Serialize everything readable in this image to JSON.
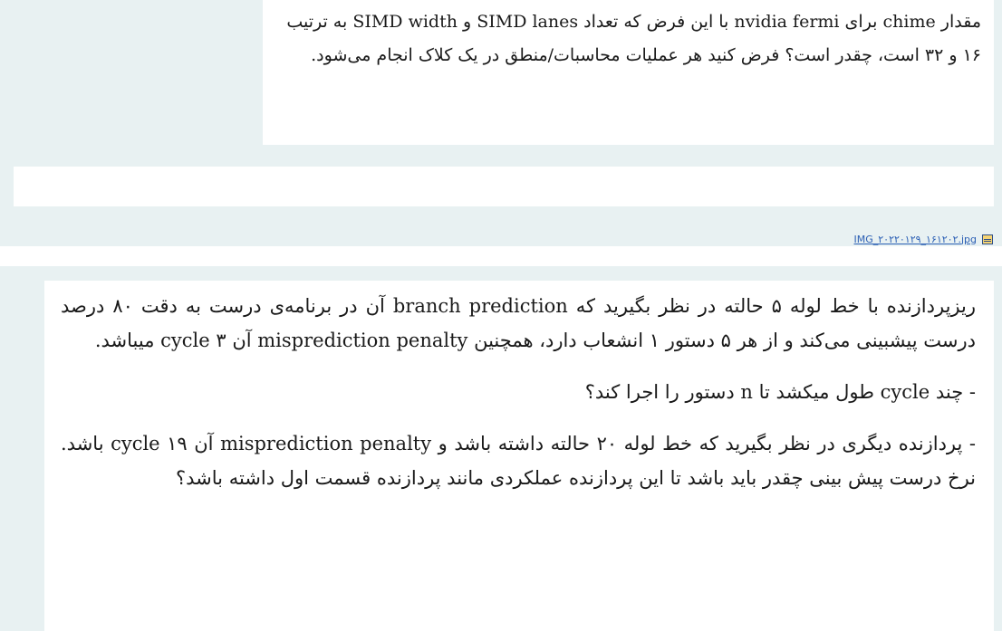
{
  "post1": {
    "question_text": "مقدار chime برای nvidia fermi با این فرض که تعداد SIMD lanes و SIMD width به ترتیب ۱۶ و ۳۲ است، چقدر است؟ فرض کنید هر عملیات محاسبات/منطق در یک کلاک انجام می‌شود.",
    "attachment": {
      "filename": "IMG_۲۰۲۲۰۱۲۹_۱۶۱۲۰۲.jpg",
      "icon": "image-file-icon"
    }
  },
  "post2": {
    "paragraph1": "ریزپردازنده با خط لوله ۵ حالته در نظر بگیرید که branch prediction آن در برنامه‌ی درست به دقت ۸۰ درصد درست پیشبینی می‌کند و از هر ۵ دستور ۱ انشعاب دارد، همچنین misprediction penalty آن ۳ cycle میباشد.",
    "paragraph2": "- چند cycle طول میکشد تا n دستور را اجرا کند؟",
    "paragraph3": "- پردازنده دیگری در نظر بگیرید که خط لوله ۲۰ حالته داشته باشد و misprediction penalty آن ۱۹ cycle باشد. نرخ درست پیش بینی چقدر باید باشد تا این پردازنده عملکردی مانند پردازنده قسمت اول داشته باشد؟"
  },
  "colors": {
    "panel_background": "#e8f1f2",
    "content_background": "#ffffff",
    "link": "#2b5fb4"
  }
}
